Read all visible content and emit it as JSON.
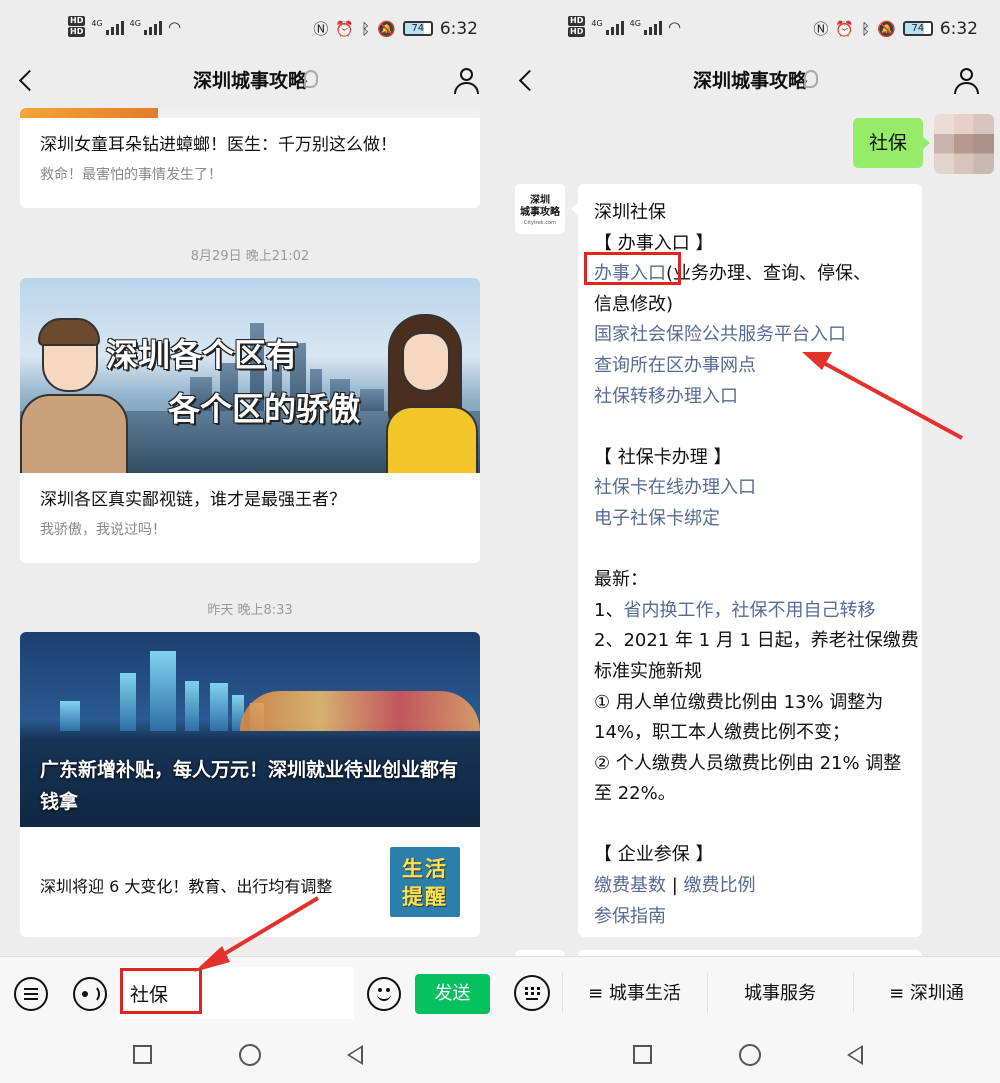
{
  "status": {
    "time": "6:32",
    "battery": "74",
    "hd1": "HD",
    "hd2": "HD",
    "net1": "4G",
    "net2": "4G"
  },
  "nav": {
    "title": "深圳城事攻略"
  },
  "left": {
    "card1": {
      "title": "深圳女童耳朵钻进蟑螂！医生：千万别这么做！",
      "sub": "救命！最害怕的事情发生了！"
    },
    "time1": "8月29日 晚上21:02",
    "card2": {
      "banner_line1": "深圳各个区有",
      "banner_line2": "各个区的骄傲",
      "title": "深圳各区真实鄙视链，谁才是最强王者？",
      "sub": "我骄傲，我说过吗！"
    },
    "time2": "昨天 晚上8:33",
    "card3": {
      "banner_title": "广东新增补贴，每人万元！深圳就业待业创业都有钱拿",
      "item_title": "深圳将迎 6 大变化！教育、出行均有调整",
      "thumb_line1": "生活",
      "thumb_line2": "提醒"
    },
    "input": {
      "value": "社保",
      "send_label": "发送"
    }
  },
  "right": {
    "my_message": "社保",
    "bot_avatar": {
      "line1": "深圳",
      "line2": "城事攻略",
      "line3": "Citytrek.com"
    },
    "reply": {
      "l1": "深圳社保",
      "l2": "【 办事入口 】",
      "l3_link": "办事入口",
      "l3_rest": "(业务办理、查询、停保、",
      "l4": "信息修改)",
      "l5": "国家社会保险公共服务平台入口",
      "l6": "查询所在区办事网点",
      "l7": "社保转移办理入口",
      "l8": "【 社保卡办理 】",
      "l9": "社保卡在线办理入口",
      "l10": "电子社保卡绑定",
      "l11": "最新：",
      "l12_prefix": "1、",
      "l12_link": "省内换工作，社保不用自己转移",
      "l13": "2、2021 年 1 月 1 日起，养老社保缴费",
      "l14": "标准实施新规",
      "l15": "① 用人单位缴费比例由 13% 调整为",
      "l16": "14%，职工本人缴费比例不变；",
      "l17": "② 个人缴费人员缴费比例由 21% 调整",
      "l18": "至 22%。",
      "l19": "【 企业参保 】",
      "l20_a": "缴费基数",
      "l20_sep": " | ",
      "l20_b": "缴费比例",
      "l21": "参保指南"
    },
    "menu": [
      "≡ 城事生活",
      "城事服务",
      "≡ 深圳通"
    ]
  }
}
